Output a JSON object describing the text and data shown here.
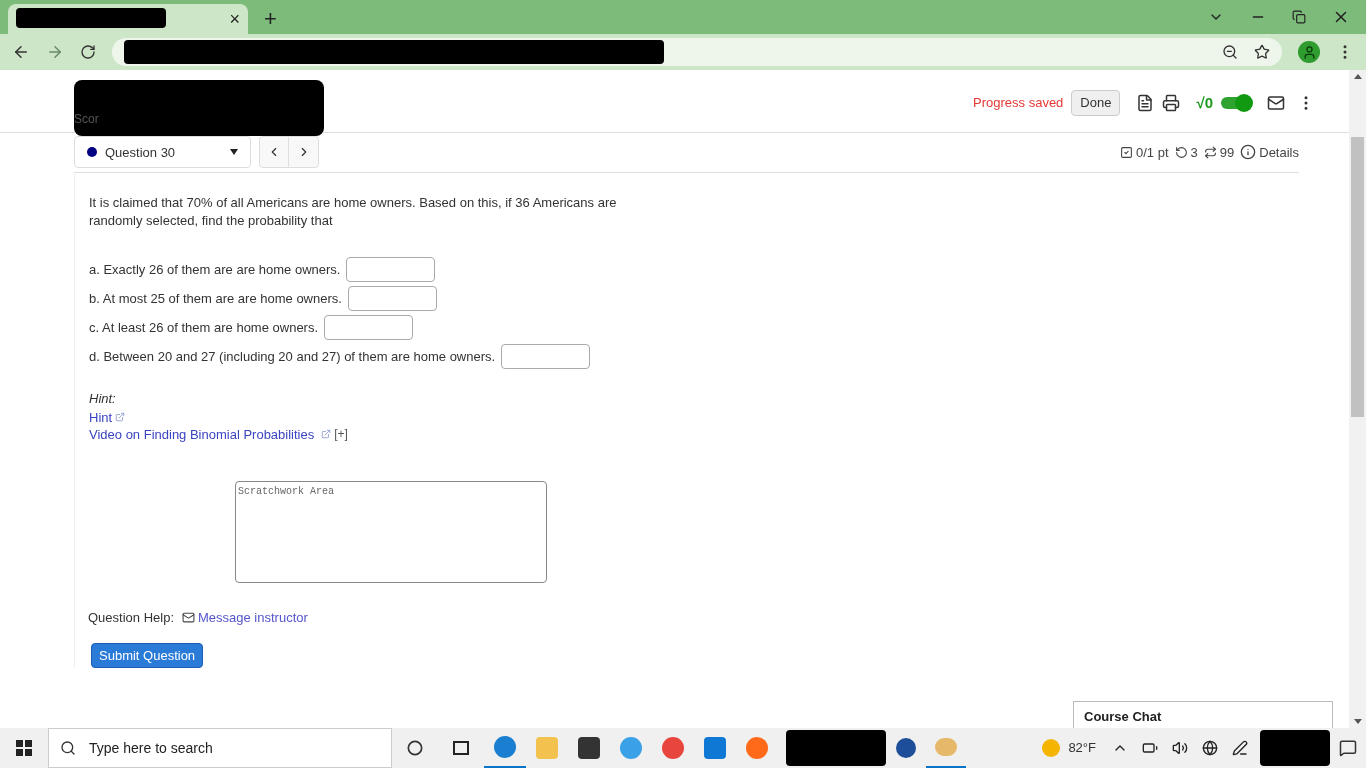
{
  "browser": {
    "tab_close": "×",
    "new_tab": "+"
  },
  "header": {
    "score_label": "Scor",
    "status": "Progress saved",
    "done": "Done",
    "math_toggle_on": true,
    "math_label": "√0"
  },
  "question_bar": {
    "selector": "Question 30",
    "stats": [
      {
        "kind": "points",
        "text": "0/1 pt"
      },
      {
        "kind": "retries",
        "text": "3"
      },
      {
        "kind": "attempts",
        "text": "99"
      },
      {
        "kind": "details",
        "text": "Details"
      }
    ]
  },
  "question": {
    "intro": "It is claimed that 70% of all Americans are home owners. Based on this, if 36 Americans are randomly selected, find the probability that",
    "parts": [
      {
        "label": "a. Exactly 26 of them are are home owners."
      },
      {
        "label": "b. At most 25 of them are are home owners."
      },
      {
        "label": "c. At least 26 of them are home owners."
      },
      {
        "label": "d. Between 20 and 27 (including 20 and 27) of them are home owners."
      }
    ],
    "hint_label": "Hint:",
    "links": [
      {
        "text": "Hint"
      },
      {
        "text": "Video on Finding Binomial Probabilities",
        "extra": "[+]"
      }
    ],
    "scratch_placeholder": "Scratchwork Area"
  },
  "help": {
    "label": "Question Help:",
    "link": "Message instructor"
  },
  "submit": "Submit Question",
  "chat": {
    "title": "Course Chat"
  },
  "taskbar": {
    "search_placeholder": "Type here to search",
    "temperature": "82°F"
  }
}
